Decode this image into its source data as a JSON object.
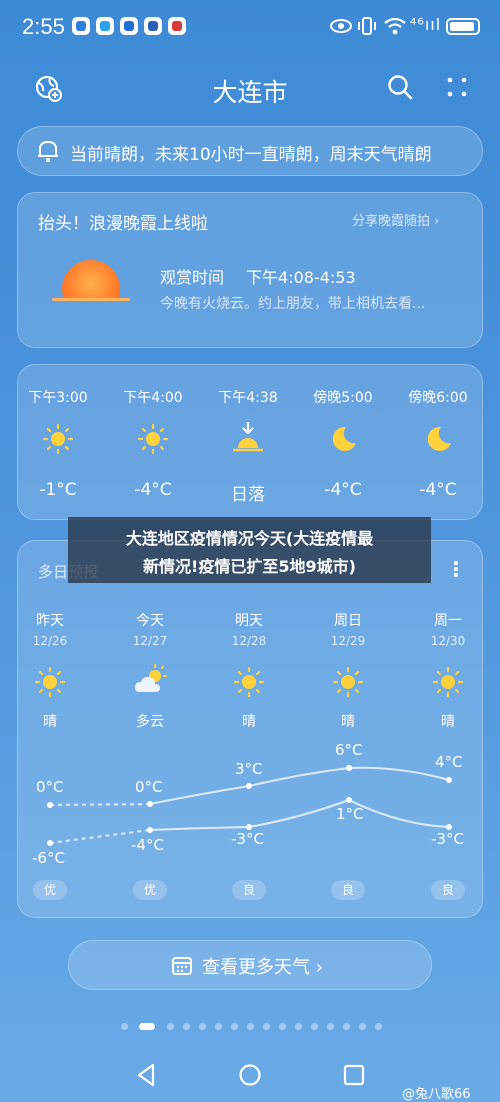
{
  "status_bar": {
    "time": "2:55",
    "signal": "⁴⁶ııl"
  },
  "header": {
    "city": "大连市"
  },
  "alert": {
    "text": "当前晴朗，未来10小时一直晴朗，周末天气晴朗"
  },
  "promo": {
    "title": "抬头！浪漫晚霞上线啦",
    "share": "分享晚霞随拍 ›",
    "view_label": "观赏时间",
    "view_time": "下午4:08-4:53",
    "desc": "今晚有火烧云。约上朋友，带上相机去看..."
  },
  "hourly": [
    {
      "time": "下午3:00",
      "icon": "sun-icon",
      "value": "-1°C"
    },
    {
      "time": "下午4:00",
      "icon": "sun-icon",
      "value": "-4°C"
    },
    {
      "time": "下午4:38",
      "icon": "sunset-icon",
      "value": "日落"
    },
    {
      "time": "傍晚5:00",
      "icon": "moon-icon",
      "value": "-4°C"
    },
    {
      "time": "傍晚6:00",
      "icon": "moon-icon",
      "value": "-4°C"
    }
  ],
  "daily": {
    "title": "多日预报",
    "days": [
      {
        "name": "昨天",
        "date": "12/26",
        "icon": "sun-icon",
        "cond": "晴",
        "high": "0°C",
        "low": "-6°C",
        "aqi": "优"
      },
      {
        "name": "今天",
        "date": "12/27",
        "icon": "partly-cloudy-icon",
        "cond": "多云",
        "high": "0°C",
        "low": "-4°C",
        "aqi": "优"
      },
      {
        "name": "明天",
        "date": "12/28",
        "icon": "sun-icon",
        "cond": "晴",
        "high": "3°C",
        "low": "-3°C",
        "aqi": "良"
      },
      {
        "name": "周日",
        "date": "12/29",
        "icon": "sun-icon",
        "cond": "晴",
        "high": "6°C",
        "low": "1°C",
        "aqi": "良"
      },
      {
        "name": "周一",
        "date": "12/30",
        "icon": "sun-icon",
        "cond": "晴",
        "high": "4°C",
        "low": "-3°C",
        "aqi": "良"
      }
    ]
  },
  "more": {
    "label": "查看更多天气 ›"
  },
  "overlay": {
    "line1": "大连地区疫情情况今天(大连疫情最",
    "line2": "新情况!疫情已扩至5地9城市)"
  },
  "watermark": "@兔八歌66",
  "colors": {
    "sun": "#ffd23c",
    "background": "#4b93dc"
  }
}
